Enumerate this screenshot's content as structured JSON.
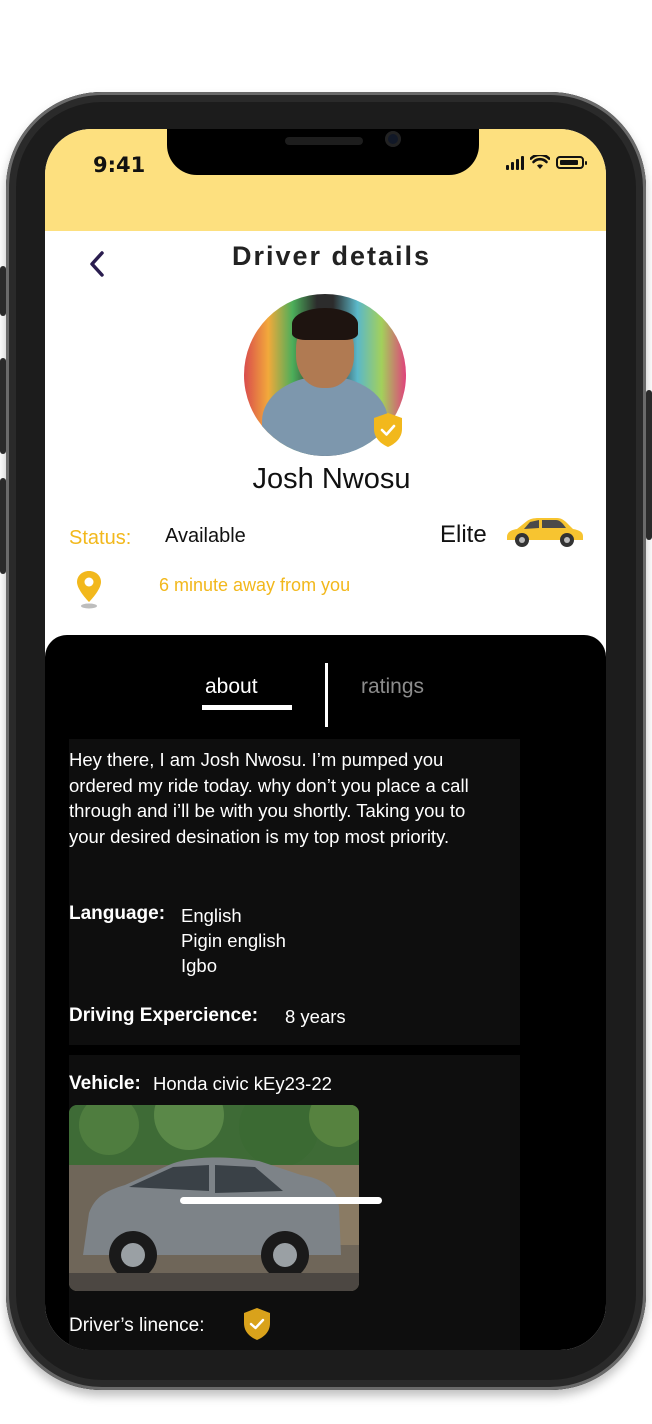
{
  "statusbar": {
    "time": "9:41"
  },
  "header": {
    "back_icon": "chevron-left-icon",
    "title": "Driver details"
  },
  "driver": {
    "name": "Josh Nwosu",
    "status_label": "Status:",
    "status_value": "Available",
    "tier": "Elite",
    "distance": "6 minute away from you"
  },
  "tabs": {
    "about": "about",
    "ratings": "ratings"
  },
  "about": {
    "bio": "Hey there, I am Josh Nwosu. I’m pumped you ordered my ride today. why don’t you place a call through and i’ll be with you shortly. Taking you to your desired desination is my  top most priority.",
    "language_label": "Language:",
    "languages": [
      "English",
      "Pigin english",
      "Igbo"
    ],
    "experience_label": "Driving Expercience:",
    "experience_value": "8 years",
    "vehicle_label": "Vehicle:",
    "vehicle_value": "Honda civic kEy23-22",
    "license_label": "Driver’s linence:"
  },
  "colors": {
    "accent": "#f2b81c",
    "statusbar": "#fde07f",
    "panel": "#000000"
  }
}
